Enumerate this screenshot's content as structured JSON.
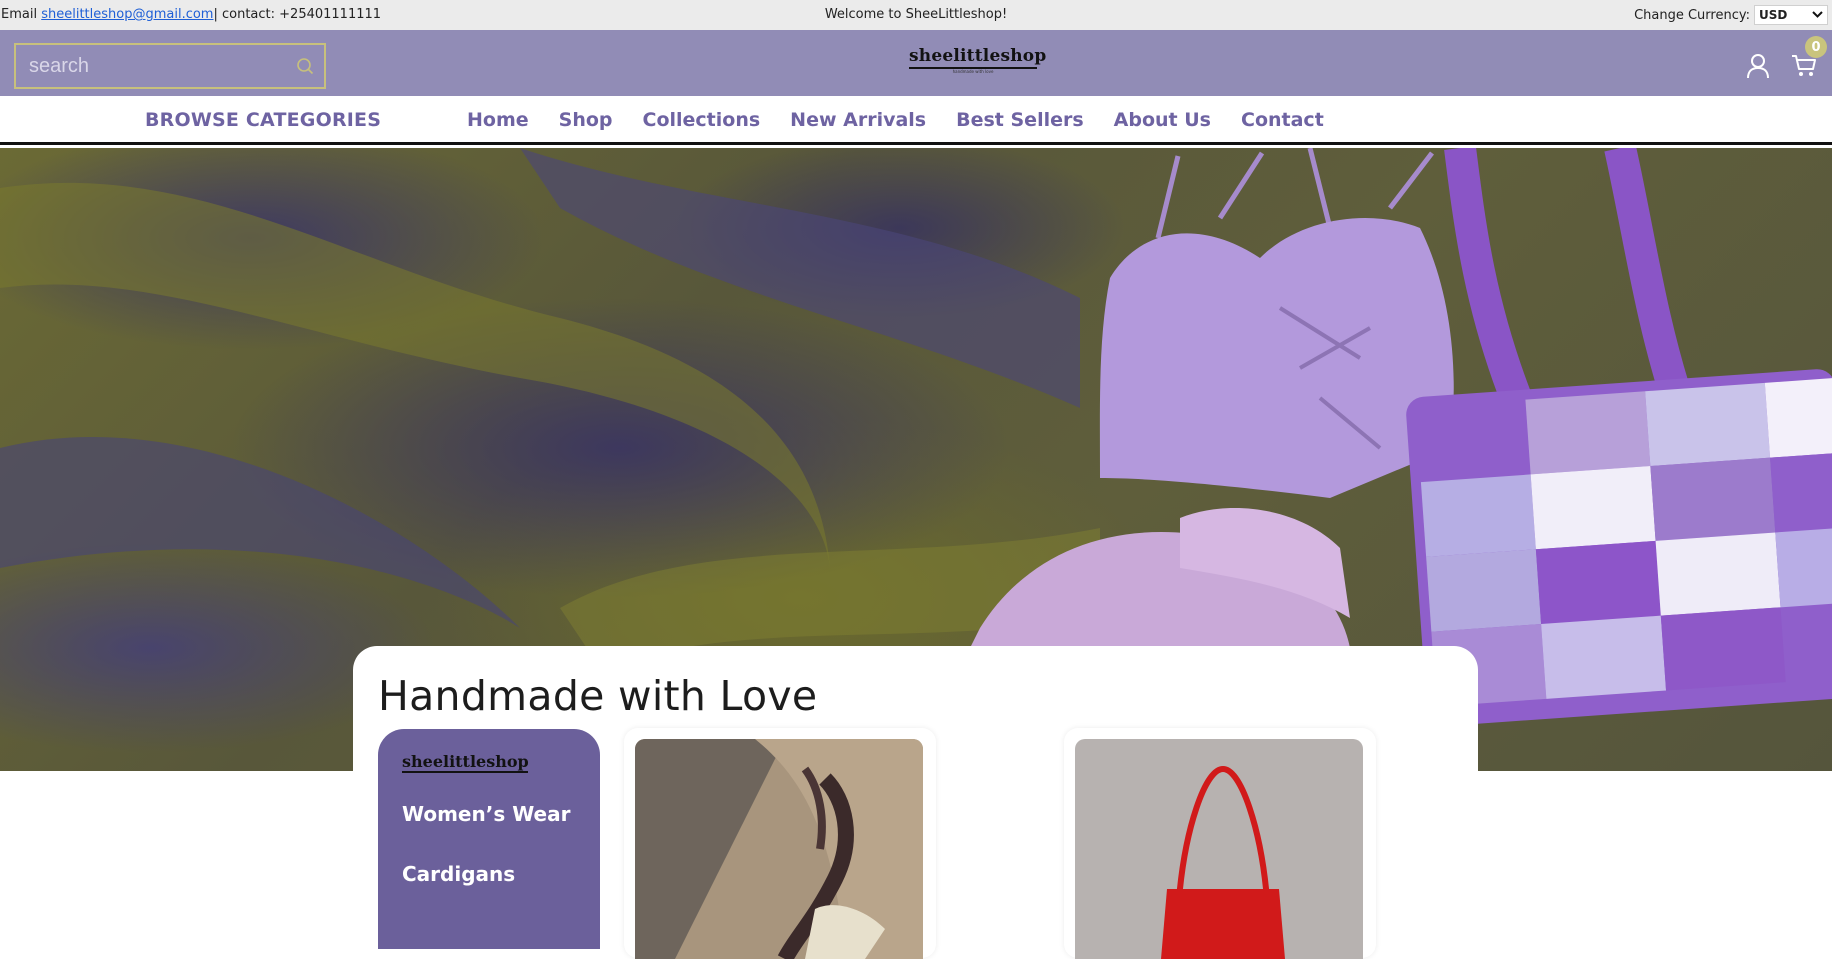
{
  "topbar": {
    "email_prefix": "Email",
    "email": "sheelittleshop@gmail.com",
    "contact": "| contact: +25401111111",
    "welcome": "Welcome to SheeLittleshop!",
    "currency_label": "Change Currency:",
    "currency_value": "USD"
  },
  "header": {
    "search_placeholder": "search",
    "logo": "sheelittleshop",
    "logo_tagline": "handmade with love",
    "cart_count": "0",
    "icons": [
      "search-icon",
      "user-icon",
      "cart-icon"
    ]
  },
  "nav": {
    "browse": "BROWSE CATEGORIES",
    "links": [
      "Home",
      "Shop",
      "Collections",
      "New Arrivals",
      "Best Sellers",
      "About Us",
      "Contact"
    ]
  },
  "section": {
    "title": "Handmade with Love",
    "panel_logo": "sheelittleshop",
    "categories": [
      "Women’s Wear",
      "Cardigans"
    ]
  },
  "colors": {
    "header_bg": "#918cb6",
    "accent": "#6e63a2",
    "search_border": "#c7c07c",
    "badge": "#c9c47d",
    "panel": "#6b609b"
  }
}
